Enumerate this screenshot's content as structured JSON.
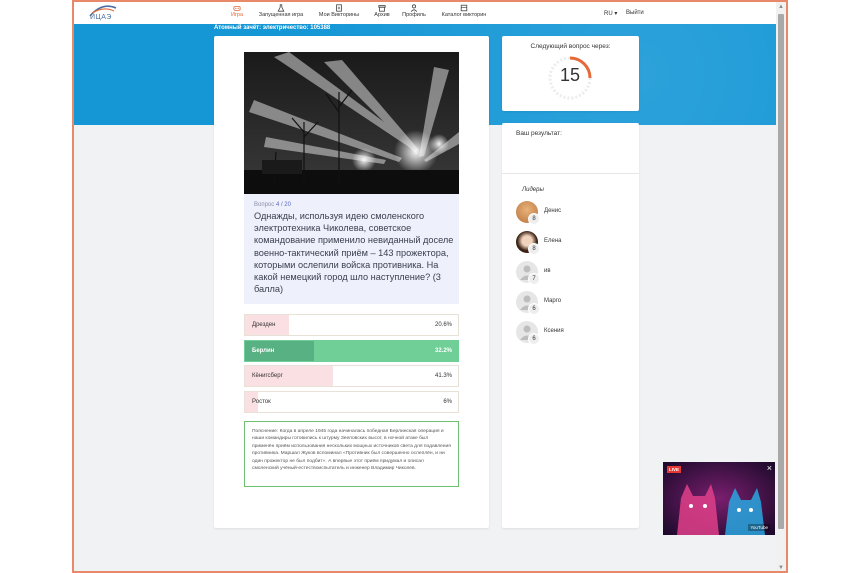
{
  "nav": {
    "logo_text": "ИЦАЭ",
    "items": [
      {
        "label": "Игра",
        "active": true,
        "icon": "gamepad-icon"
      },
      {
        "label": "Запущенная игра",
        "active": false,
        "icon": "flask-icon"
      },
      {
        "label": "Мои Викторины",
        "active": false,
        "icon": "document-icon"
      },
      {
        "label": "Архив",
        "active": false,
        "icon": "archive-icon"
      },
      {
        "label": "Профиль",
        "active": false,
        "icon": "user-icon"
      },
      {
        "label": "Каталог викторин",
        "active": false,
        "icon": "catalog-icon"
      }
    ],
    "lang": "RU",
    "logout": "Выйти"
  },
  "banner": {
    "title": "Атомный зачёт: электричество: 105388"
  },
  "question": {
    "label": "Вопрос",
    "number": "4 / 20",
    "text": "Однажды, используя идею смоленского электротехника Чиколева, советское командование применило невиданный доселе военно-тактический приём – 143 прожектора, которыми ослепили войска противника. На какой немецкий город шло наступление? (3 балла)"
  },
  "answers": [
    {
      "label": "Дрезден",
      "percent": "20.6%",
      "share": 0.206,
      "correct": false
    },
    {
      "label": "Берлин",
      "percent": "32.2%",
      "share": 0.322,
      "correct": true
    },
    {
      "label": "Кёнигсберг",
      "percent": "41.3%",
      "share": 0.413,
      "correct": false
    },
    {
      "label": "Росток",
      "percent": "6%",
      "share": 0.06,
      "correct": false
    }
  ],
  "explanation": "Пояснение: Когда в апреле 1945 года начиналась победная Берлинская операция и наши командиры готовились к штурму Зееловских высот, в ночной атаке был применён приём использования нескольких мощных источников света для подавления противника. Маршал Жуков вспоминал «Противник был совершенно ослеплён, и ни один прожектор не был подбит». А впервые этот приём придумал и описал смоленский учёный-естествоиспытатель и инженер Владимир Чиколев.",
  "timer": {
    "title": "Следующий вопрос через:",
    "value": "15",
    "remaining_fraction": 0.25,
    "accent": "#e46a3a"
  },
  "result": {
    "title": "Ваш результат:"
  },
  "leaders": {
    "title": "Лидеры",
    "items": [
      {
        "name": "Денис",
        "score": "8",
        "avatar": "photo-avatar-1"
      },
      {
        "name": "Елена",
        "score": "8",
        "avatar": "photo-avatar-2"
      },
      {
        "name": "ив",
        "score": "7",
        "avatar": "default-avatar"
      },
      {
        "name": "Марго",
        "score": "6",
        "avatar": "default-avatar"
      },
      {
        "name": "Ксения",
        "score": "6",
        "avatar": "default-avatar"
      }
    ]
  },
  "video": {
    "live_label": "LIVE",
    "close_label": "×",
    "source_label": "YouTube"
  },
  "colors": {
    "brand_blue": "#1597d6",
    "accent_orange": "#e46a3a",
    "correct_green": "#6fcf97",
    "wrong_pink": "#fbe0e3"
  }
}
